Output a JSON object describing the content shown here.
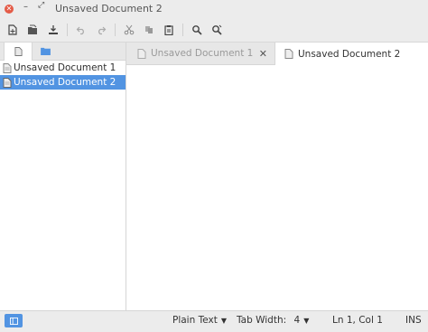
{
  "window": {
    "title": "Unsaved Document 2"
  },
  "toolbar": {
    "buttons": [
      "new-document-icon",
      "open-icon",
      "save-icon",
      "undo-icon",
      "redo-icon",
      "cut-icon",
      "copy-icon",
      "paste-icon",
      "find-icon",
      "find-replace-icon"
    ]
  },
  "sidebar": {
    "tabs": [
      "documents-icon",
      "file-browser-icon"
    ],
    "documents": [
      {
        "label": "Unsaved Document 1"
      },
      {
        "label": "Unsaved Document 2"
      }
    ]
  },
  "tabs": [
    {
      "label": "Unsaved Document 1"
    },
    {
      "label": "Unsaved Document 2"
    }
  ],
  "status": {
    "language": "Plain Text",
    "tab_width_label": "Tab Width:",
    "tab_width_value": "4",
    "position": "Ln 1, Col 1",
    "mode": "INS"
  },
  "colors": {
    "accent": "#5294e2",
    "close": "#e45b47",
    "chrome": "#ececec"
  }
}
